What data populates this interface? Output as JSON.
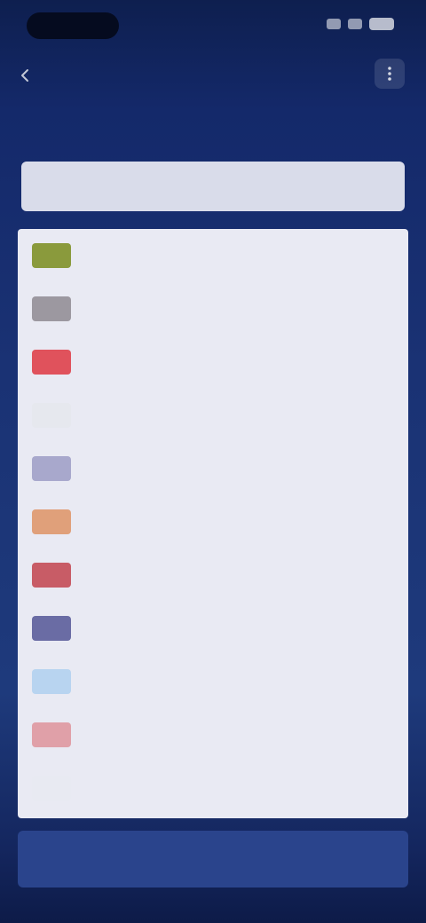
{
  "header": {
    "title": "",
    "back_icon": "arrow-left-icon",
    "menu_icon": "more-icon"
  },
  "search": {
    "value": "",
    "placeholder": ""
  },
  "countries": [
    {
      "name": "",
      "flag_color": "#8a9a3c"
    },
    {
      "name": "",
      "flag_color": "#9c98a0"
    },
    {
      "name": "",
      "flag_color": "#e0525c"
    },
    {
      "name": "",
      "flag_color": "#e6e8ee"
    },
    {
      "name": "",
      "flag_color": "#a8a8cc"
    },
    {
      "name": "",
      "flag_color": "#e0a07a"
    },
    {
      "name": "",
      "flag_color": "#c85c66"
    },
    {
      "name": "",
      "flag_color": "#6a6ca4"
    },
    {
      "name": "",
      "flag_color": "#b8d4f0"
    },
    {
      "name": "",
      "flag_color": "#e0a0a8"
    },
    {
      "name": "",
      "flag_color": "#e8eaf2"
    }
  ],
  "footer": {
    "continue_label": ""
  },
  "colors": {
    "background": "#1a3274",
    "list_background": "#e9eaf3",
    "button": "#2a448c"
  }
}
